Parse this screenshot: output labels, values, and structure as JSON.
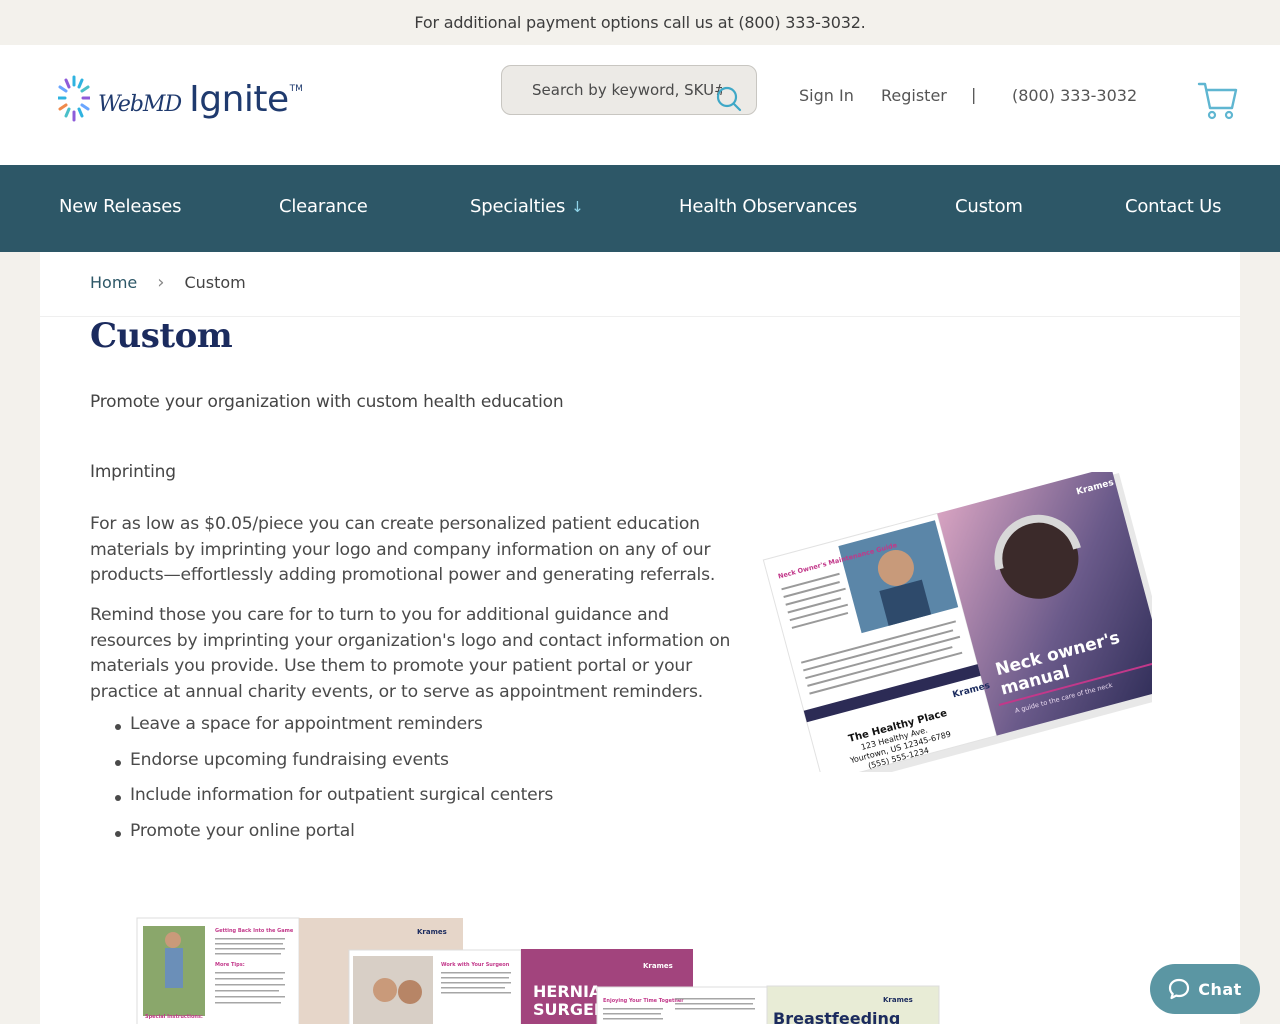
{
  "topbar": {
    "text": "For additional payment options call us at (800) 333-3032."
  },
  "header": {
    "logo": {
      "brand": "WebMD",
      "product": "Ignite",
      "tm": "TM"
    },
    "search": {
      "placeholder": "Search by keyword, SKU#"
    },
    "sign_in": "Sign In",
    "register": "Register",
    "separator": "|",
    "phone": "(800) 333-3032"
  },
  "nav": {
    "items": [
      {
        "label": "New Releases"
      },
      {
        "label": "Clearance"
      },
      {
        "label": "Specialties",
        "arrow": "↓"
      },
      {
        "label": "Health Observances"
      },
      {
        "label": "Custom"
      },
      {
        "label": "Contact Us"
      }
    ]
  },
  "breadcrumb": {
    "home": "Home",
    "sep": "›",
    "current": "Custom"
  },
  "main": {
    "title": "Custom",
    "subtitle": "Promote your organization with custom health education",
    "section_heading": "Imprinting",
    "para1": "For as low as $0.05/piece you can create personalized patient education materials by imprinting your logo and company information on any of our products—effortlessly adding promotional power and generating referrals.",
    "para2": "Remind those you care for to turn to you for additional guidance and resources by imprinting your organization's logo and contact information on materials you provide. Use them to promote your patient portal or your practice at annual charity events, or to serve as appointment reminders.",
    "bullets": [
      "Leave a space for appointment reminders",
      "Endorse upcoming fundraising events",
      "Include information for outpatient surgical centers",
      "Promote your online portal"
    ]
  },
  "brochure_neck": {
    "brand": "Krames",
    "title_line1": "Neck owner's",
    "title_line2": "manual",
    "tagline": "A guide to the care of the neck",
    "guide_title": "Neck Owner's Maintenance Guide",
    "place_name": "The Healthy Place",
    "place_addr1": "123 Healthy Ave.",
    "place_addr2": "Yourtown, US 12345-6789",
    "place_phone": "(555) 555-1234"
  },
  "brochures_row": {
    "b1_title": "Getting Back Into the Game",
    "b1_sub": "More Tips:",
    "b1_special": "Special Instructions:",
    "b2_title": "Work with Your Surgeon",
    "b3_title1": "HERNIA",
    "b3_title2": "SURGER",
    "b4_title": "Enjoying Your Time Together",
    "b5_title": "Breastfeeding",
    "brand": "Krames"
  },
  "chat": {
    "label": "Chat"
  },
  "colors": {
    "nav_bg": "#2d5767",
    "title": "#1b2b5e",
    "accent": "#6ab8cf",
    "chat": "#5b96a3",
    "krames_pink": "#c2388a"
  }
}
